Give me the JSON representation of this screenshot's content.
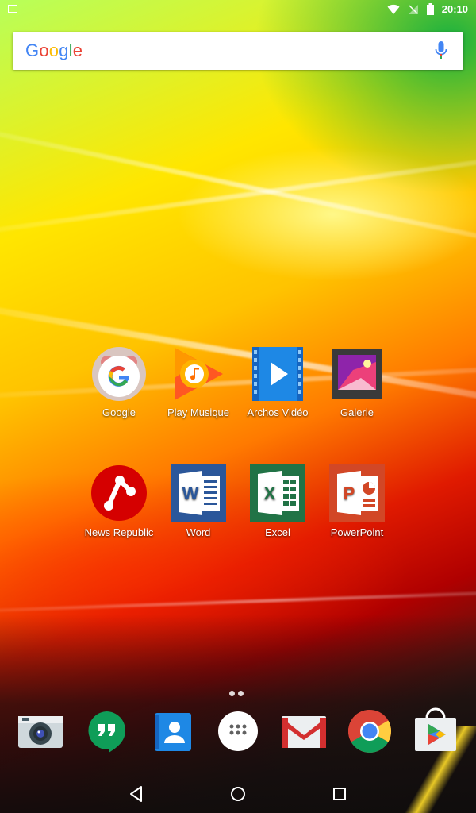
{
  "status_bar": {
    "time": "20:10"
  },
  "search": {
    "logo_text": "Google"
  },
  "home_apps": [
    {
      "label": "Google",
      "icon": "google-app-icon"
    },
    {
      "label": "Play Musique",
      "icon": "play-music-icon"
    },
    {
      "label": "Archos Vidéo",
      "icon": "video-icon"
    },
    {
      "label": "Galerie",
      "icon": "gallery-icon"
    },
    {
      "label": "News Republic",
      "icon": "news-republic-icon"
    },
    {
      "label": "Word",
      "icon": "word-icon"
    },
    {
      "label": "Excel",
      "icon": "excel-icon"
    },
    {
      "label": "PowerPoint",
      "icon": "powerpoint-icon"
    }
  ],
  "dock": [
    {
      "icon": "camera-icon"
    },
    {
      "icon": "hangouts-icon"
    },
    {
      "icon": "contacts-icon"
    },
    {
      "icon": "app-drawer-icon"
    },
    {
      "icon": "gmail-icon"
    },
    {
      "icon": "chrome-icon"
    },
    {
      "icon": "play-store-icon"
    }
  ],
  "colors": {
    "google_blue": "#4285F4",
    "google_red": "#EA4335",
    "google_yellow": "#FBBC05",
    "google_green": "#34A853",
    "word_blue": "#2B579A",
    "excel_green": "#217346",
    "powerpoint_red": "#D24726"
  }
}
